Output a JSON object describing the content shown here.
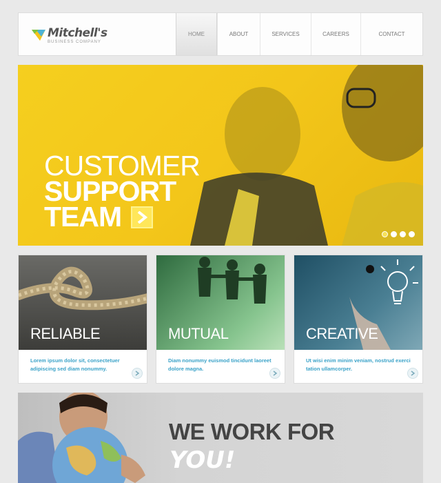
{
  "header": {
    "logo_name": "Mitchell's",
    "logo_sub": "BUSINESS COMPANY",
    "nav": [
      {
        "label": "HOME",
        "active": true
      },
      {
        "label": "ABOUT"
      },
      {
        "label": "SERVICES"
      },
      {
        "label": "CAREERS"
      },
      {
        "label": "CONTACT"
      }
    ]
  },
  "hero": {
    "line1": "CUSTOMER",
    "line2": "SUPPORT",
    "line3": "TEAM",
    "slides": 4,
    "active_slide": 1,
    "arrow_icon": "chevron-right-icon"
  },
  "cards": [
    {
      "title": "RELIABLE",
      "text": "Lorem ipsum dolor sit, consectetuer adipiscing sed diam nonummy."
    },
    {
      "title": "MUTUAL",
      "text": "Diam nonummy euismod tincidunt laoreet dolore magna."
    },
    {
      "title": "CREATIVE",
      "text": "Ut wisi enim minim veniam, nostrud exerci tation ullamcorper."
    }
  ],
  "banner": {
    "line1": "WE WORK FOR",
    "line2": "YOU!"
  },
  "colors": {
    "accent_yellow": "#f5cf1f",
    "link_blue": "#3aa2c8"
  }
}
